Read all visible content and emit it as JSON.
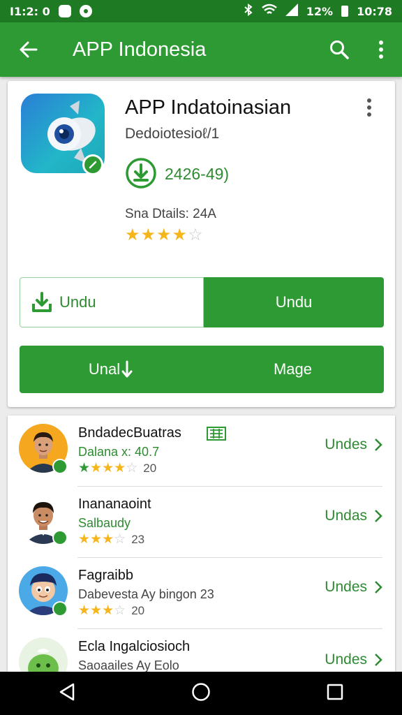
{
  "status_bar": {
    "left_text": "I1:2: 0",
    "battery": "12%",
    "time": "10:78"
  },
  "app_bar": {
    "title": "APP Indonesia"
  },
  "app": {
    "title": "APP Indatoinasian",
    "developer": "Dedoiotesioℓ/1",
    "downloads": "2426-49)",
    "size_label": "Sna Dtails: 24A",
    "rating_stars": 4,
    "buttons": {
      "outline_label": "Undu",
      "primary_label": "Undu",
      "wide_left_label": "Unal",
      "wide_right_label": "Mage"
    }
  },
  "list": [
    {
      "name": "BndadecBuatras",
      "sub": "Dalana x: 40.7",
      "sub_green": true,
      "stars": 3.5,
      "count": "20",
      "action": "Undes",
      "flag": true
    },
    {
      "name": "Inananaoint",
      "sub": "Salbaudy",
      "sub_green": true,
      "stars": 3.5,
      "count": "23",
      "action": "Undas",
      "flag": false
    },
    {
      "name": "Fagraibb",
      "sub": "Dabevesta Ay bingon 23",
      "sub_green": false,
      "stars": 3,
      "count": "20",
      "action": "Undes",
      "flag": false
    },
    {
      "name": "Ecla Ingalciosioch",
      "sub": "Saoaailes Ay Eolo",
      "sub_green": false,
      "stars": 0,
      "count": "",
      "action": "Undes",
      "flag": false
    }
  ],
  "colors": {
    "primary": "#2e9a33",
    "status_bar": "#1f7a24",
    "star": "#f5b51b"
  }
}
